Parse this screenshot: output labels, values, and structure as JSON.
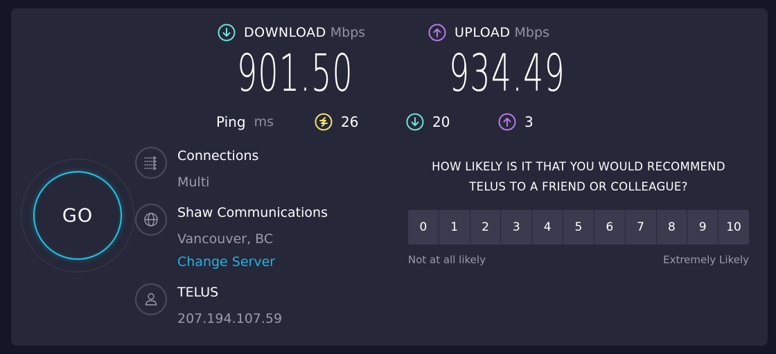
{
  "download": {
    "label": "DOWNLOAD",
    "unit": "Mbps",
    "value": "901.50"
  },
  "upload": {
    "label": "UPLOAD",
    "unit": "Mbps",
    "value": "934.49"
  },
  "ping": {
    "label": "Ping",
    "unit": "ms",
    "idle": "26",
    "download": "20",
    "upload": "3"
  },
  "go": {
    "label": "GO"
  },
  "connections": {
    "title": "Connections",
    "value": "Multi"
  },
  "server": {
    "title": "Shaw Communications",
    "location": "Vancouver, BC",
    "change_label": "Change Server"
  },
  "isp": {
    "title": "TELUS",
    "ip": "207.194.107.59"
  },
  "survey": {
    "question_line1": "HOW LIKELY IS IT THAT YOU WOULD RECOMMEND",
    "question_line2": "TELUS TO A FRIEND OR COLLEAGUE?",
    "options": [
      "0",
      "1",
      "2",
      "3",
      "4",
      "5",
      "6",
      "7",
      "8",
      "9",
      "10"
    ],
    "low_label": "Not at all likely",
    "high_label": "Extremely Likely"
  },
  "colors": {
    "download_accent": "#6ee2d8",
    "upload_accent": "#b77be8",
    "idle_ping_accent": "#f2e36a",
    "go_ring": "#1fc6e6",
    "link": "#1fb4e4"
  },
  "icons": {
    "download": "arrow-down-circle-icon",
    "upload": "arrow-up-circle-icon",
    "idle_ping": "lightning-circle-icon",
    "connections": "connections-icon",
    "server": "globe-icon",
    "isp": "user-icon"
  }
}
